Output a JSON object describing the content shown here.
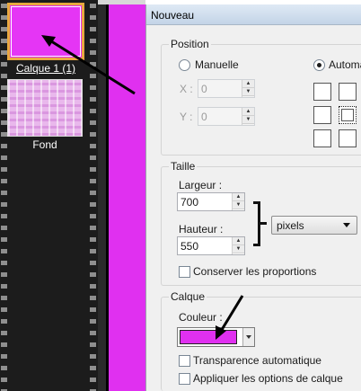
{
  "layers": {
    "items": [
      {
        "label": "Calque 1 (1)",
        "swatch": "#e030f0",
        "selected": true
      },
      {
        "label": "Fond",
        "swatch": "#e9b8ec",
        "selected": false
      }
    ]
  },
  "dialog": {
    "title": "Nouveau",
    "position": {
      "title": "Position",
      "manual_label": "Manuelle",
      "auto_label": "Automa",
      "mode": "Automa",
      "x_label": "X :",
      "x_value": "0",
      "y_label": "Y :",
      "y_value": "0"
    },
    "size": {
      "title": "Taille",
      "width_label": "Largeur :",
      "width_value": "700",
      "height_label": "Hauteur :",
      "height_value": "550",
      "unit": "pixels",
      "keep_ratio_label": "Conserver les proportions",
      "keep_ratio_checked": false
    },
    "layer": {
      "title": "Calque",
      "color_label": "Couleur :",
      "color_value": "#e030f0",
      "auto_transparency_label": "Transparence automatique",
      "auto_transparency_checked": false,
      "apply_options_label": "Appliquer les options de calque",
      "apply_options_checked": false
    }
  },
  "icons": [
    "arrow-annotation-icon",
    "chevron-down-icon",
    "spin-up-icon",
    "spin-down-icon"
  ]
}
